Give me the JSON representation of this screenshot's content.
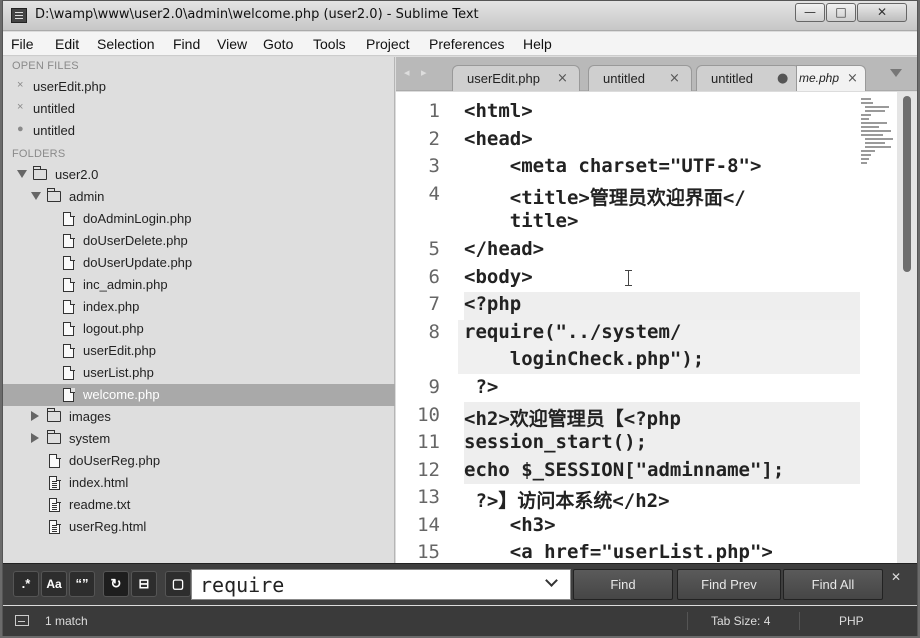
{
  "window": {
    "title": "D:\\wamp\\www\\user2.0\\admin\\welcome.php (user2.0) - Sublime Text",
    "min_label": "—",
    "max_label": "□",
    "close_label": "✕"
  },
  "menu": [
    "File",
    "Edit",
    "Selection",
    "Find",
    "View",
    "Goto",
    "Tools",
    "Project",
    "Preferences",
    "Help"
  ],
  "sidebar": {
    "open_files_header": "OPEN FILES",
    "open_files": [
      {
        "label": "userEdit.php",
        "mark": "×"
      },
      {
        "label": "untitled",
        "mark": "×"
      },
      {
        "label": "untitled",
        "mark": "●"
      }
    ],
    "folders_header": "FOLDERS",
    "tree": [
      {
        "label": "user2.0",
        "kind": "folder",
        "expanded": true
      },
      {
        "label": "admin",
        "kind": "folder",
        "expanded": true
      },
      {
        "label": "doAdminLogin.php",
        "kind": "file"
      },
      {
        "label": "doUserDelete.php",
        "kind": "file"
      },
      {
        "label": "doUserUpdate.php",
        "kind": "file"
      },
      {
        "label": "inc_admin.php",
        "kind": "file"
      },
      {
        "label": "index.php",
        "kind": "file"
      },
      {
        "label": "logout.php",
        "kind": "file"
      },
      {
        "label": "userEdit.php",
        "kind": "file"
      },
      {
        "label": "userList.php",
        "kind": "file"
      },
      {
        "label": "welcome.php",
        "kind": "file",
        "selected": true
      },
      {
        "label": "images",
        "kind": "folder",
        "expanded": false
      },
      {
        "label": "system",
        "kind": "folder",
        "expanded": false
      },
      {
        "label": "doUserReg.php",
        "kind": "file"
      },
      {
        "label": "index.html",
        "kind": "file-lined"
      },
      {
        "label": "readme.txt",
        "kind": "file-lined"
      },
      {
        "label": "userReg.html",
        "kind": "file-lined"
      }
    ]
  },
  "tabs": [
    {
      "label": "userEdit.php",
      "state": "×"
    },
    {
      "label": "untitled",
      "state": "×"
    },
    {
      "label": "untitled",
      "state": "●"
    },
    {
      "label": "me.php",
      "state": "×",
      "active": true
    }
  ],
  "tab_nav": "◂ ▸",
  "editor": {
    "line_numbers": [
      "1",
      "2",
      "3",
      "4",
      "",
      "5",
      "6",
      "7",
      "8",
      "",
      "9",
      "10",
      "11",
      "12",
      "13",
      "14",
      "15"
    ],
    "lines": [
      "<html>",
      "<head>",
      "    <meta charset=\"UTF-8\">",
      "    <title>管理员欢迎界面</",
      "    title>",
      "</head>",
      "<body>",
      "<?php",
      "require(\"../system/",
      "    loginCheck.php\");",
      " ?>",
      "<h2>欢迎管理员【<?php",
      "session_start();",
      "echo $_SESSION[\"adminname\"];",
      " ?>】访问本系统</h2>",
      "    <h3>",
      "    <a href=\"userList.php\">"
    ]
  },
  "find": {
    "opt_regex": ".*",
    "opt_case": "Aa",
    "opt_word": "“”",
    "opt_wrap": "↻",
    "opt_insel": "⊟",
    "opt_highlight": "▢",
    "query": "require",
    "find_label": "Find",
    "find_prev_label": "Find Prev",
    "find_all_label": "Find All",
    "close_label": "✕"
  },
  "status": {
    "match": "1 match",
    "tab_size": "Tab Size: 4",
    "syntax": "PHP"
  }
}
